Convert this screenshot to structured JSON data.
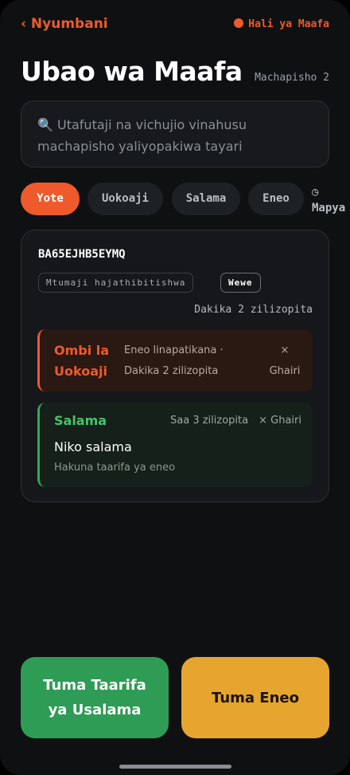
{
  "header": {
    "back_label": "‹ Nyumbani",
    "status_label": "Hali ya Maafa",
    "title": "Ubao wa Maafa",
    "post_count_label": "Machapisho 2"
  },
  "search": {
    "icon": "magnifier-icon",
    "placeholder": "🔍 Utafutaji na vichujio vinahusu machapisho yaliyopakiwa tayari"
  },
  "filters": {
    "chips": [
      {
        "label": "Yote",
        "active": true
      },
      {
        "label": "Uokoaji",
        "active": false
      },
      {
        "label": "Salama",
        "active": false
      },
      {
        "label": "Eneo",
        "active": false
      }
    ],
    "sort_icon": "clock-icon",
    "sort_label": "◷ Mapya"
  },
  "post": {
    "id": "BA65EJHB5EYMQ",
    "unverified_badge": "Mtumaji hajathibitishwa",
    "you_badge": "Wewe",
    "time": "Dakika 2 zilizopita",
    "entries": [
      {
        "type": "Ombi la Uokoaji",
        "meta": "Eneo linapatikana · Dakika 2 zilizopita",
        "dismiss": "× Ghairi"
      },
      {
        "type": "Salama",
        "time": "Saa 3 zilizopita",
        "dismiss": "× Ghairi",
        "message": "Niko salama",
        "location": "Hakuna taarifa ya eneo"
      }
    ]
  },
  "actions": {
    "safety_button": "Tuma Taarifa ya Usalama",
    "location_button": "Tuma Eneo"
  },
  "colors": {
    "accent": "#ee5a2b",
    "safe": "#2e9c55",
    "location": "#e5a52e",
    "background": "#0f1012"
  }
}
